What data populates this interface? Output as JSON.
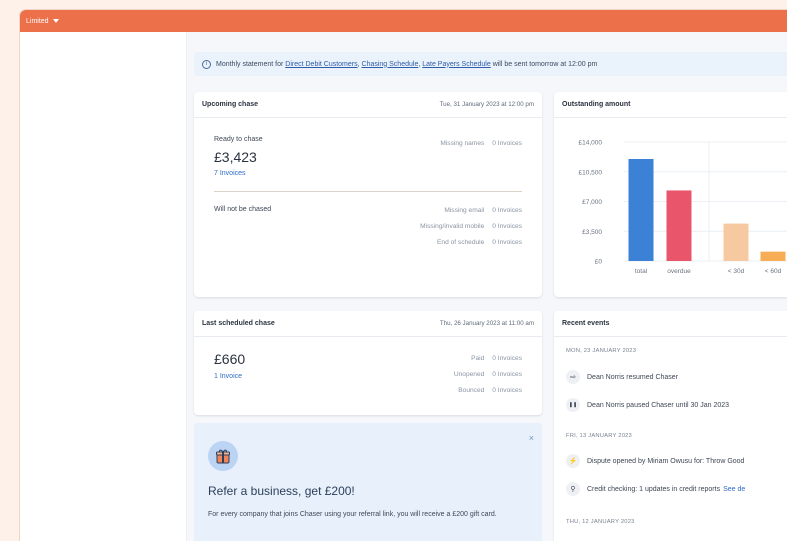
{
  "topbar": {
    "company": "Limited"
  },
  "banner": {
    "prefix": "Monthly statement for",
    "link1": "Direct Debit Customers",
    "link2": "Chasing Schedule",
    "link3": "Late Payers Schedule",
    "suffix": "will be sent tomorrow at 12:00 pm"
  },
  "upcoming": {
    "title": "Upcoming chase",
    "date": "Tue, 31 January 2023 at 12:00 pm",
    "ready_label": "Ready to chase",
    "amount": "£3,423",
    "invoices_link": "7 Invoices",
    "missing_names_label": "Missing names",
    "missing_names_value": "0 Invoices",
    "not_chased_label": "Will not be chased",
    "rows": [
      {
        "label": "Missing email",
        "value": "0 Invoices"
      },
      {
        "label": "Missing/invalid mobile",
        "value": "0 Invoices"
      },
      {
        "label": "End of schedule",
        "value": "0 Invoices"
      }
    ]
  },
  "last": {
    "title": "Last scheduled chase",
    "date": "Thu, 26 January 2023 at 11:00 am",
    "amount": "£660",
    "invoices_link": "1 Invoice",
    "rows": [
      {
        "label": "Paid",
        "value": "0 Invoices"
      },
      {
        "label": "Unopened",
        "value": "0 Invoices"
      },
      {
        "label": "Bounced",
        "value": "0 Invoices"
      }
    ]
  },
  "refer": {
    "title": "Refer a business, get £200!",
    "desc": "For every company that joins Chaser using your referral link, you will receive a £200 gift card.",
    "close": "×"
  },
  "outstanding": {
    "title": "Outstanding amount"
  },
  "chart_data": {
    "type": "bar",
    "categories": [
      "total",
      "overdue",
      "< 30d",
      "< 60d"
    ],
    "values": [
      12000,
      8300,
      4400,
      1100
    ],
    "colors": [
      "#3b82d6",
      "#e9556a",
      "#f7c9a0",
      "#f6ad55"
    ],
    "ylim": [
      0,
      14000
    ],
    "yticks": [
      0,
      3500,
      7000,
      10500,
      14000
    ],
    "ytick_labels": [
      "£0",
      "£3,500",
      "£7,000",
      "£10,500",
      "£14,000"
    ]
  },
  "events": {
    "title": "Recent events",
    "groups": [
      {
        "date": "MON, 23 JANUARY 2023",
        "items": [
          {
            "icon": "play-resume-icon",
            "glyph": "⇨",
            "text": "Dean Norris resumed Chaser"
          },
          {
            "icon": "pause-icon",
            "glyph": "❚❚",
            "text": "Dean Norris paused Chaser until 30 Jan 2023"
          }
        ]
      },
      {
        "date": "FRI, 13 JANUARY 2023",
        "items": [
          {
            "icon": "dispute-icon",
            "glyph": "⚡",
            "text": "Dispute opened by Miriam Owusu for: Throw Good"
          },
          {
            "icon": "search-icon",
            "glyph": "⚲",
            "text": "Credit checking: 1 updates in credit reports",
            "link": "See de"
          }
        ]
      },
      {
        "date": "THU, 12 JANUARY 2023",
        "items": []
      }
    ]
  }
}
